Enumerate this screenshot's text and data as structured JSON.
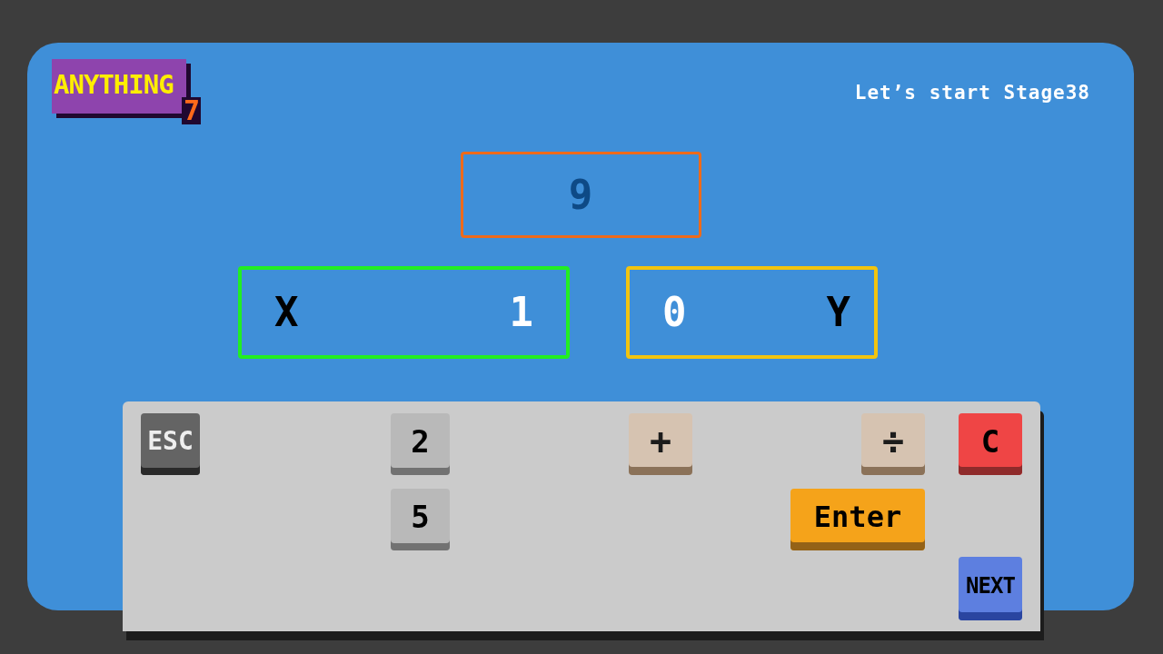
{
  "logo": {
    "text": "ANYTHING",
    "badge": "7"
  },
  "stage_message": "Let’s start Stage38",
  "target": "9",
  "slots": [
    {
      "color": "#22ee22",
      "items": [
        {
          "text": "X",
          "kind": "variable"
        },
        {
          "text": "1",
          "kind": "number"
        }
      ]
    },
    {
      "color": "#f2c40f",
      "items": [
        {
          "text": "0",
          "kind": "number"
        },
        {
          "text": "Y",
          "kind": "variable"
        }
      ]
    }
  ],
  "keys": [
    {
      "label": "ESC",
      "kind": "escape"
    },
    {
      "label": "2",
      "kind": "digit"
    },
    {
      "label": "+",
      "kind": "operator"
    },
    {
      "label": "÷",
      "kind": "operator"
    },
    {
      "label": "C",
      "kind": "clear"
    },
    {
      "label": "5",
      "kind": "digit"
    },
    {
      "label": "Enter",
      "kind": "enter"
    },
    {
      "label": "NEXT",
      "kind": "next"
    }
  ]
}
